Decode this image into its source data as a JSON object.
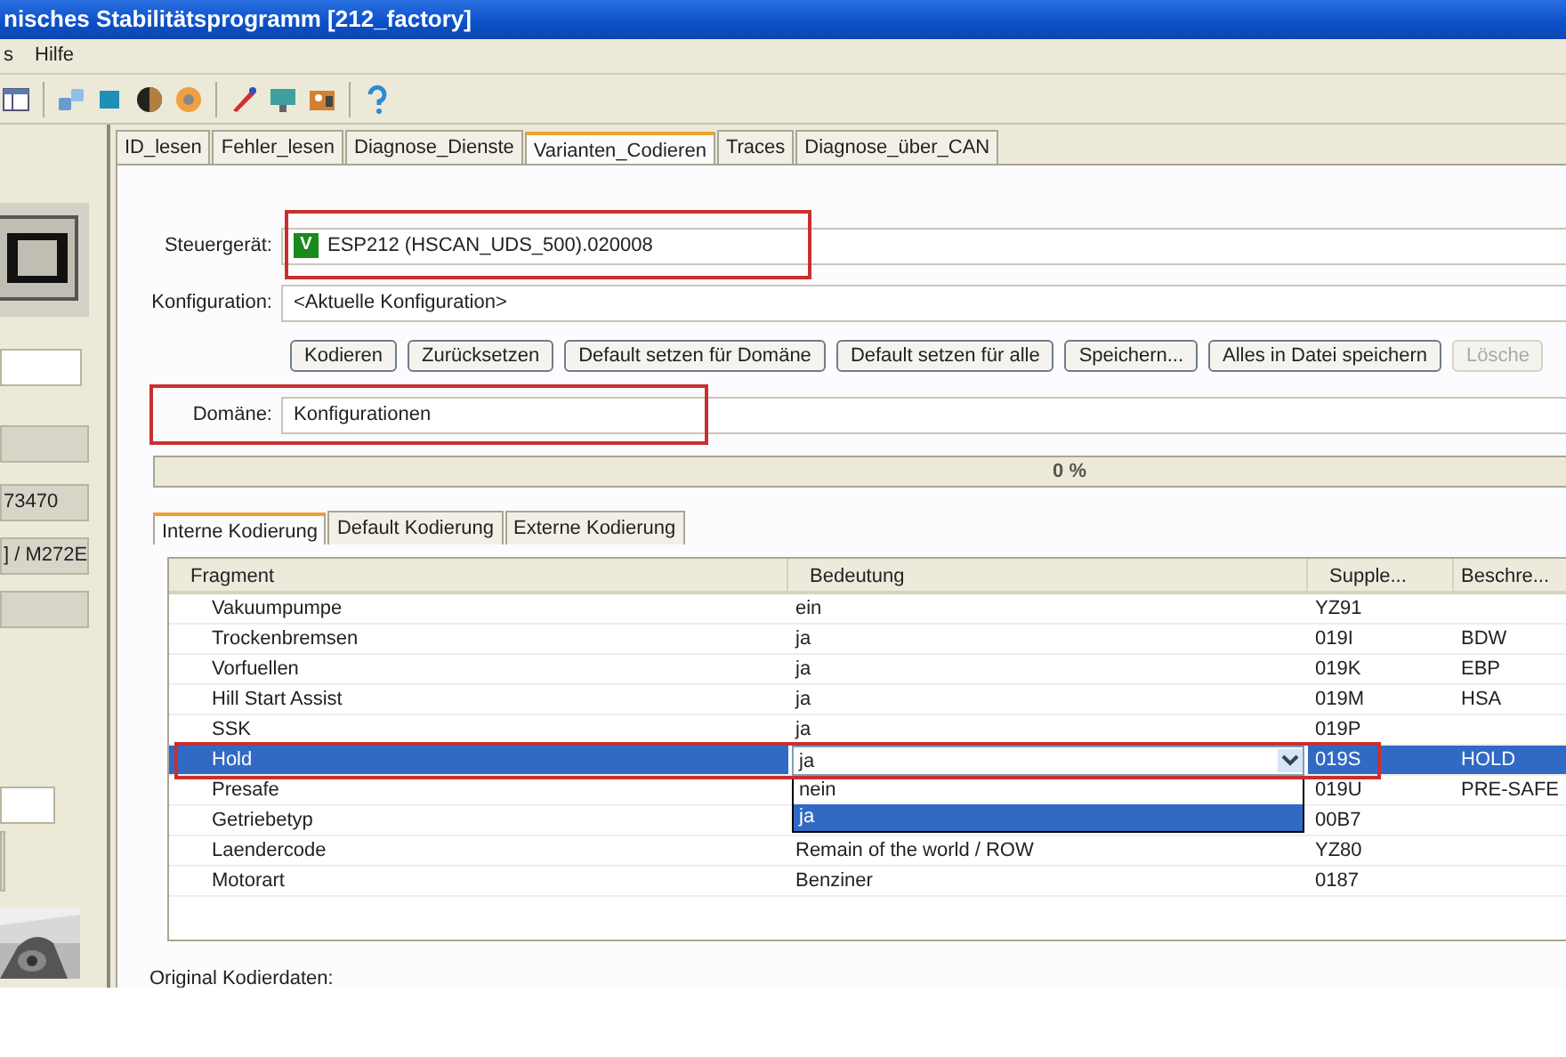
{
  "window": {
    "title": "nisches Stabilitätsprogramm [212_factory]"
  },
  "menu": [
    "s",
    "Hilfe"
  ],
  "left_panel": {
    "fields": [
      {
        "kind": "input"
      },
      {
        "kind": "grey"
      },
      {
        "kind": "grey",
        "text": "73470"
      },
      {
        "kind": "grey",
        "text": "] / M272E"
      },
      {
        "kind": "grey"
      }
    ]
  },
  "tabs": [
    {
      "label": "ID_lesen",
      "selected": false
    },
    {
      "label": "Fehler_lesen",
      "selected": false
    },
    {
      "label": "Diagnose_Dienste",
      "selected": false
    },
    {
      "label": "Varianten_Codieren",
      "selected": true
    },
    {
      "label": "Traces",
      "selected": false
    },
    {
      "label": "Diagnose_über_CAN",
      "selected": false
    }
  ],
  "steuergeraet": {
    "label": "Steuergerät:",
    "badge": "V",
    "value": "ESP212 (HSCAN_UDS_500).020008",
    "highlighted": true
  },
  "konfiguration": {
    "label": "Konfiguration:",
    "value": "<Aktuelle Konfiguration>"
  },
  "buttons": [
    {
      "label": "Kodieren",
      "disabled": false
    },
    {
      "label": "Zurücksetzen",
      "disabled": false
    },
    {
      "label": "Default setzen für Domäne",
      "disabled": false
    },
    {
      "label": "Default setzen für alle",
      "disabled": false
    },
    {
      "label": "Speichern...",
      "disabled": false
    },
    {
      "label": "Alles in Datei speichern",
      "disabled": false
    },
    {
      "label": "Lösche",
      "disabled": true
    }
  ],
  "domaene": {
    "label": "Domäne:",
    "value": "Konfigurationen",
    "highlighted": true
  },
  "progress": {
    "level": 0,
    "reading": "0 %"
  },
  "subtabs": [
    {
      "label": "Interne Kodierung",
      "selected": true
    },
    {
      "label": "Default Kodierung",
      "selected": false
    },
    {
      "label": "Externe Kodierung",
      "selected": false
    }
  ],
  "table": {
    "columns": [
      "Fragment",
      "Bedeutung",
      "Supple...",
      "Beschre..."
    ],
    "rows": [
      {
        "fragment": "Vakuumpumpe",
        "bedeutung": "ein",
        "supplement": "YZ91",
        "selected": false
      },
      {
        "fragment": "Trockenbremsen",
        "bedeutung": "ja",
        "supplement": "019I",
        "beschreibung": "BDW",
        "selected": false
      },
      {
        "fragment": "Vorfuellen",
        "bedeutung": "ja",
        "supplement": "019K",
        "beschreibung": "EBP",
        "selected": false
      },
      {
        "fragment": "Hill Start Assist",
        "bedeutung": "ja",
        "supplement": "019M",
        "beschreibung": "HSA",
        "selected": false
      },
      {
        "fragment": "SSK",
        "bedeutung": "ja",
        "supplement": "019P",
        "selected": false
      },
      {
        "fragment": "Hold",
        "supplement": "019S",
        "beschreibung": "HOLD",
        "selected": true,
        "highlighted": true,
        "editor": {
          "value": "ja",
          "options": [
            {
              "label": "nein",
              "selected": false
            },
            {
              "label": "ja",
              "selected": true
            }
          ]
        }
      },
      {
        "fragment": "Presafe",
        "supplement": "019U",
        "beschreibung": "PRE-SAFE",
        "selected": false
      },
      {
        "fragment": "Getriebetyp",
        "supplement": "00B7",
        "selected": false
      },
      {
        "fragment": "Laendercode",
        "bedeutung": "Remain of the world / ROW",
        "supplement": "YZ80",
        "selected": false
      },
      {
        "fragment": "Motorart",
        "bedeutung": "Benziner",
        "supplement": "0187",
        "selected": false
      }
    ]
  },
  "footer_label": "Original Kodierdaten:"
}
